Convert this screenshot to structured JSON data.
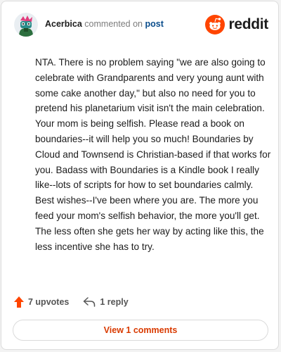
{
  "comment": {
    "author": "Acerbica",
    "action_text": "commented on",
    "target_text": "post",
    "body": "NTA. There is no problem saying \"we are also going to celebrate with Grandparents and very young aunt with some cake another day,\" but also no need for you to pretend his planetarium visit isn't the main celebration. Your mom is being selfish. Please read a book on boundaries--it will help you so much! Boundaries by Cloud and Townsend is Christian-based if that works for you. Badass with Boundaries is a Kindle book I really like--lots of scripts for how to set boundaries calmly. Best wishes--I've been where you are. The more you feed your mom's selfish behavior, the more you'll get. The less often she gets her way by acting like this, the less incentive she has to try."
  },
  "brand": {
    "name": "reddit",
    "logo_icon": "reddit-alien-icon",
    "accent": "#ff4500"
  },
  "actions": {
    "upvotes_label": "7 upvotes",
    "upvote_icon": "upvote-arrow-icon",
    "replies_label": "1 reply",
    "reply_icon": "reply-arrow-icon"
  },
  "footer": {
    "view_comments_label": "View 1 comments"
  },
  "colors": {
    "upvote": "#ff4500",
    "link": "#0a4d8c",
    "view_button_text": "#d93a00"
  }
}
